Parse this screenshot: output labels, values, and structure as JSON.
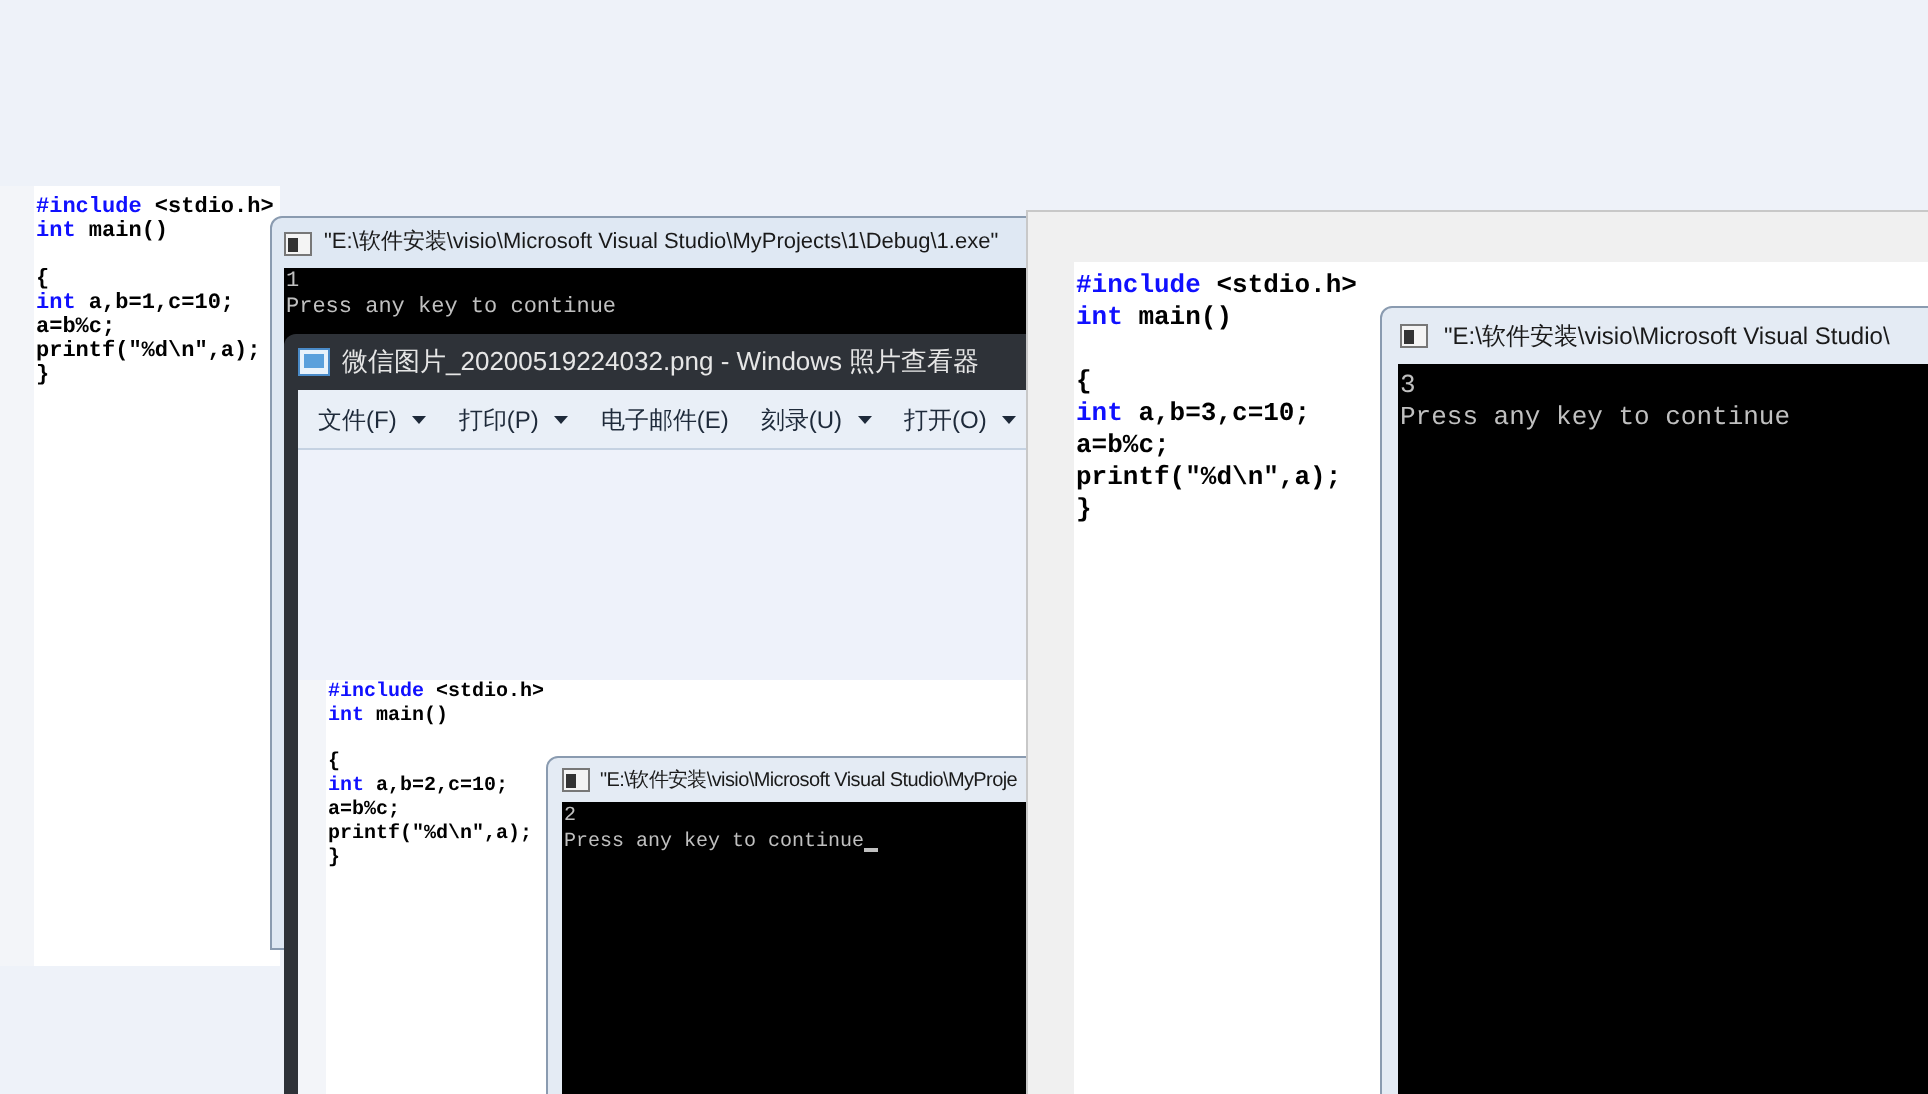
{
  "windows": [
    {
      "kind": "editor",
      "code": [
        [
          [
            {
              "text": "#include",
              "kind": "keyword"
            },
            {
              "text": " <stdio.h>",
              "kind": "plain"
            }
          ],
          [
            {
              "text": "int",
              "kind": "keyword"
            },
            {
              "text": " main()",
              "kind": "plain"
            }
          ]
        ],
        [
          [
            {
              "text": "{",
              "kind": "plain"
            }
          ],
          [
            {
              "text": "int",
              "kind": "keyword"
            },
            {
              "text": " a,b=1,c=10;",
              "kind": "plain"
            }
          ],
          [
            {
              "text": "a=b%c;",
              "kind": "plain"
            }
          ],
          [
            {
              "text": "printf(\"%d\\n\",a);",
              "kind": "plain"
            }
          ],
          [
            {
              "text": "}",
              "kind": "plain"
            }
          ]
        ]
      ]
    },
    {
      "kind": "console",
      "title": "\"E:\\软件安装\\visio\\Microsoft Visual Studio\\MyProjects\\1\\Debug\\1.exe\"",
      "output": [
        "1",
        "Press any key to continue"
      ],
      "cursor": false
    },
    {
      "kind": "photo_viewer",
      "title": "微信图片_20200519224032.png - Windows 照片查看器",
      "menu": [
        {
          "label": "文件(F)",
          "dropdown": true
        },
        {
          "label": "打印(P)",
          "dropdown": true
        },
        {
          "label": "电子邮件(E)",
          "dropdown": false
        },
        {
          "label": "刻录(U)",
          "dropdown": true
        },
        {
          "label": "打开(O)",
          "dropdown": true
        }
      ],
      "image": {
        "code": [
          [
            [
              {
                "text": "#include",
                "kind": "keyword"
              },
              {
                "text": " <stdio.h>",
                "kind": "plain"
              }
            ],
            [
              {
                "text": "int",
                "kind": "keyword"
              },
              {
                "text": " main()",
                "kind": "plain"
              }
            ]
          ],
          [
            [
              {
                "text": "{",
                "kind": "plain"
              }
            ],
            [
              {
                "text": "int",
                "kind": "keyword"
              },
              {
                "text": " a,b=2,c=10;",
                "kind": "plain"
              }
            ],
            [
              {
                "text": "a=b%c;",
                "kind": "plain"
              }
            ],
            [
              {
                "text": "printf(\"%d\\n\",a);",
                "kind": "plain"
              }
            ],
            [
              {
                "text": "}",
                "kind": "plain"
              }
            ]
          ]
        ],
        "console": {
          "title": "\"E:\\软件安装\\visio\\Microsoft Visual Studio\\MyProje",
          "output": [
            "2",
            "Press any key to continue"
          ],
          "cursor": true
        }
      }
    },
    {
      "kind": "editor",
      "code": [
        [
          [
            {
              "text": "#include",
              "kind": "keyword"
            },
            {
              "text": " <stdio.h>",
              "kind": "plain"
            }
          ],
          [
            {
              "text": "int",
              "kind": "keyword"
            },
            {
              "text": " main()",
              "kind": "plain"
            }
          ]
        ],
        [
          [
            {
              "text": "{",
              "kind": "plain"
            }
          ],
          [
            {
              "text": "int",
              "kind": "keyword"
            },
            {
              "text": " a,b=3,c=10;",
              "kind": "plain"
            }
          ],
          [
            {
              "text": "a=b%c;",
              "kind": "plain"
            }
          ],
          [
            {
              "text": "printf(\"%d\\n\",a);",
              "kind": "plain"
            }
          ],
          [
            {
              "text": "}",
              "kind": "plain"
            }
          ]
        ]
      ]
    },
    {
      "kind": "console",
      "title": "\"E:\\软件安装\\visio\\Microsoft Visual Studio\\",
      "output": [
        "3",
        "Press any key to continue"
      ],
      "cursor": false
    }
  ]
}
